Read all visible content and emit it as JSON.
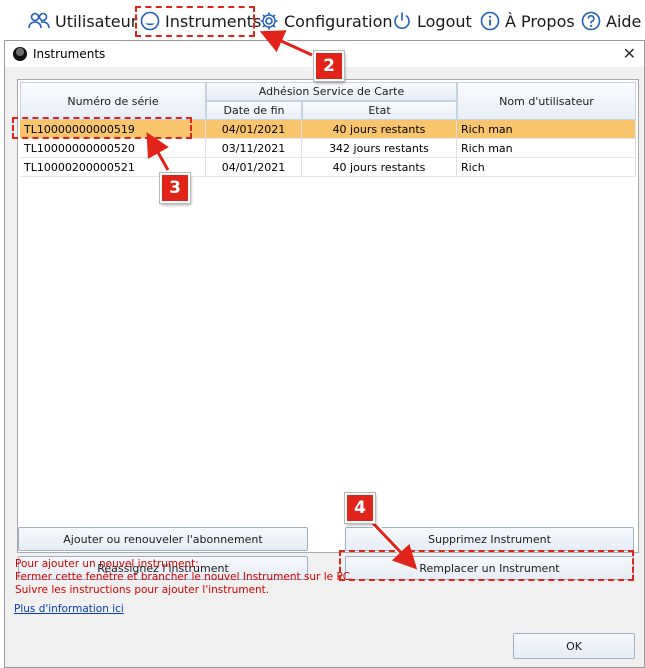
{
  "menubar": {
    "items": [
      {
        "label": "Utilisateur",
        "icon": "users-icon"
      },
      {
        "label": "Instruments",
        "icon": "instrument-icon"
      },
      {
        "label": "Configuration",
        "icon": "gear-icon"
      },
      {
        "label": "Logout",
        "icon": "power-icon"
      },
      {
        "label": "À Propos",
        "icon": "info-icon"
      },
      {
        "label": "Aide",
        "icon": "help-icon"
      }
    ]
  },
  "dialog": {
    "title": "Instruments",
    "close_label": "✕",
    "table": {
      "group_header": "Adhésion Service de Carte",
      "columns": {
        "serial": "Numéro de série",
        "end_date": "Date de fin",
        "status": "Etat",
        "user": "Nom d'utilisateur"
      },
      "rows": [
        {
          "serial": "TL10000000000519",
          "end_date": "04/01/2021",
          "status": "40 jours restants",
          "user": "Rich man"
        },
        {
          "serial": "TL10000000000520",
          "end_date": "03/11/2021",
          "status": "342 jours restants",
          "user": "Rich man"
        },
        {
          "serial": "TL10000200000521",
          "end_date": "04/01/2021",
          "status": "40 jours restants",
          "user": "Rich"
        }
      ]
    },
    "buttons": {
      "add_renew": "Ajouter ou renouveler l'abonnement",
      "delete": "Supprimez Instrument",
      "reassign": "Réassignez l'instrument",
      "replace": "Remplacer un Instrument",
      "ok": "OK"
    },
    "info_lines": [
      "Pour ajouter un nouvel instrument:",
      "Fermer cette fenêtre et brancher le nouvel Instrument sur le PC.",
      "Suivre les instructions pour ajouter l'instrument."
    ],
    "more_info_link": "Plus  d'information ici"
  },
  "callouts": [
    "2",
    "3",
    "4"
  ],
  "colors": {
    "accent": "#e2231a",
    "selection": "#f8c46c",
    "icon_blue": "#1f5fbf",
    "info_red": "#d40000"
  }
}
